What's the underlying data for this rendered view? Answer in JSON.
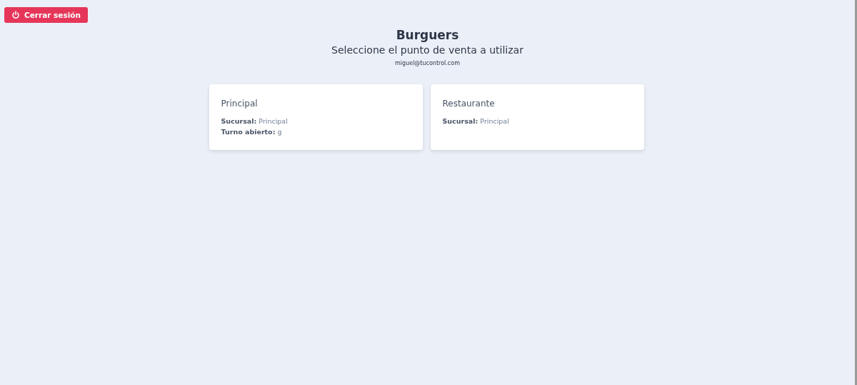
{
  "logout_button": {
    "label": "Cerrar sesión"
  },
  "header": {
    "title": "Burguers",
    "subtitle": "Seleccione el punto de venta a utilizar",
    "email": "miguel@tucontrol.com"
  },
  "points_of_sale": [
    {
      "name": "Principal",
      "fields": [
        {
          "label": "Sucursal:",
          "value": "Principal"
        },
        {
          "label": "Turno abierto:",
          "value": "g"
        }
      ]
    },
    {
      "name": "Restaurante",
      "fields": [
        {
          "label": "Sucursal:",
          "value": "Principal"
        }
      ]
    }
  ]
}
